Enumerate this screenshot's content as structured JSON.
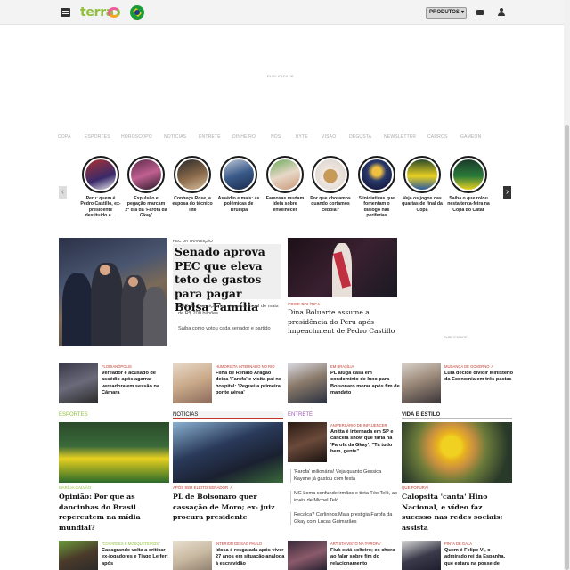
{
  "header": {
    "logo": "terra",
    "products_label": "PRODUTOS",
    "menu_icon": "hamburger-icon",
    "flag_icon": "brazil-flag-icon",
    "mail_icon": "mail-icon",
    "user_icon": "user-icon"
  },
  "ad": {
    "label": "PUBLICIDADE",
    "label2": "PUBLICIDADE"
  },
  "categories": [
    "COPA",
    "ESPORTES",
    "HORÓSCOPO",
    "NOTÍCIAS",
    "ENTRETÊ",
    "DINHEIRO",
    "NÓS",
    "BYTE",
    "VISÃO",
    "DEGUSTA",
    "NEWSLETTER",
    "CARROS",
    "GAMEON"
  ],
  "stories": [
    {
      "caption": "Peru: quem é Pedro Castillo, ex-presidente destituído e ..."
    },
    {
      "caption": "Expulsão e pegação marcam 2º dia da 'Farofa da Gkay'"
    },
    {
      "caption": "Conheça Rose, a esposa do técnico Tite"
    },
    {
      "caption": "Assédio e mais: as polêmicas de Tirullipa"
    },
    {
      "caption": "Famosas mudam ideia sobre envelhecer"
    },
    {
      "caption": "Por que choramos quando cortamos cebola?"
    },
    {
      "caption": "5 iniciativas que fomentam o diálogo nas periferias"
    },
    {
      "caption": "Veja os jogos das quartas de final da Copa"
    },
    {
      "caption": "Saiba o que rolou nesta terça-feira na Copa do Catar"
    }
  ],
  "hero": {
    "kicker": "PEC DA TRANSIÇÃO",
    "title": "Senado aprova PEC que eleva teto de gastos para pagar Bolsa Família",
    "bullets": [
      "PEC da Transição tem impacto fiscal de mais de R$ 200 bilhões",
      "Saiba como votou cada senador e partido"
    ]
  },
  "side": {
    "kicker": "CRISE POLÍTICA",
    "title": "Dina Boluarte assume a presidência do Peru após impeachment de Pedro Castillo"
  },
  "row_cards": [
    {
      "kicker": "FLORIANÓPOLIS",
      "title": "Vereador é acusado de assédio após agarrar vereadora em sessão na Câmara"
    },
    {
      "kicker": "HUMORISTA INTERNADO NO RIO",
      "title": "Filha de Renato Aragão deixa 'Farofa' e visita pai no hospital: 'Peguei a primeira ponte aérea'"
    },
    {
      "kicker": "EM BRASÍLIA",
      "title": "PL aluga casa em condomínio de luxo para Bolsonaro morar após fim de mandato"
    },
    {
      "kicker": "MUDANÇA DE GOVERNO ↗",
      "title": "Lula decide dividir Ministério da Economia em três pastas"
    }
  ],
  "sections": [
    {
      "name": "ESPORTES",
      "color": "#8fbf3c",
      "kicker": "MARÍLIA GALVÃO",
      "title": "Opinião: Por que as dancinhas do Brasil repercutem na mídia mundial?"
    },
    {
      "name": "NOTÍCIAS",
      "color": "#c0392b",
      "kicker": "APÓS SER ELEITO SENADOR ↗",
      "title": "PL de Bolsonaro quer cassação de Moro; ex- juiz procura presidente"
    },
    {
      "name": "ENTRETÊ",
      "color": "#9b59b6",
      "kicker": "ANIVERSÁRIO DE INFLUENCER",
      "title": "Anitta é internada em SP e cancela show que faria na 'Farofa da Gkay'; \"Tá tudo bem, gente\""
    },
    {
      "name": "VIDA E ESTILO",
      "color": "#9e9e9e",
      "kicker": "QUE FOFURA!",
      "title": "Calopsita 'canta' Hino Nacional, e vídeo faz sucesso nas redes sociais; assista"
    }
  ],
  "ent_bullets": [
    "'Farofa' milionária! Veja quanto Gessica Kayane já gastou com festa",
    "MC Loma confunde irmãos e tieta Téo Teló, ao invés de Michel Teló",
    "Recalca? Carlinhos Maia prestigia Farofa da Gkay com Lucas Guimarães"
  ],
  "bottom_cards": [
    {
      "kicker": "\"COVARDES E MOSQUETEIROS\"",
      "title": "Casagrande volta a criticar ex-jogadores e Tiago Leifert após"
    },
    {
      "kicker": "INTERIOR DE SÃO PAULO",
      "title": "Idosa é resgatada após viver 27 anos em situação análoga à escravidão"
    },
    {
      "kicker": "ARTISTA VISTO NA 'FAROFA'",
      "title": "Fiuk está solteiro; ex chora ao falar sobre fim do relacionamento"
    },
    {
      "kicker": "PINTA DE GALÃ",
      "title": "Quem é Felipe VI, o admirado rei da Espanha, que estará na posse de"
    }
  ]
}
